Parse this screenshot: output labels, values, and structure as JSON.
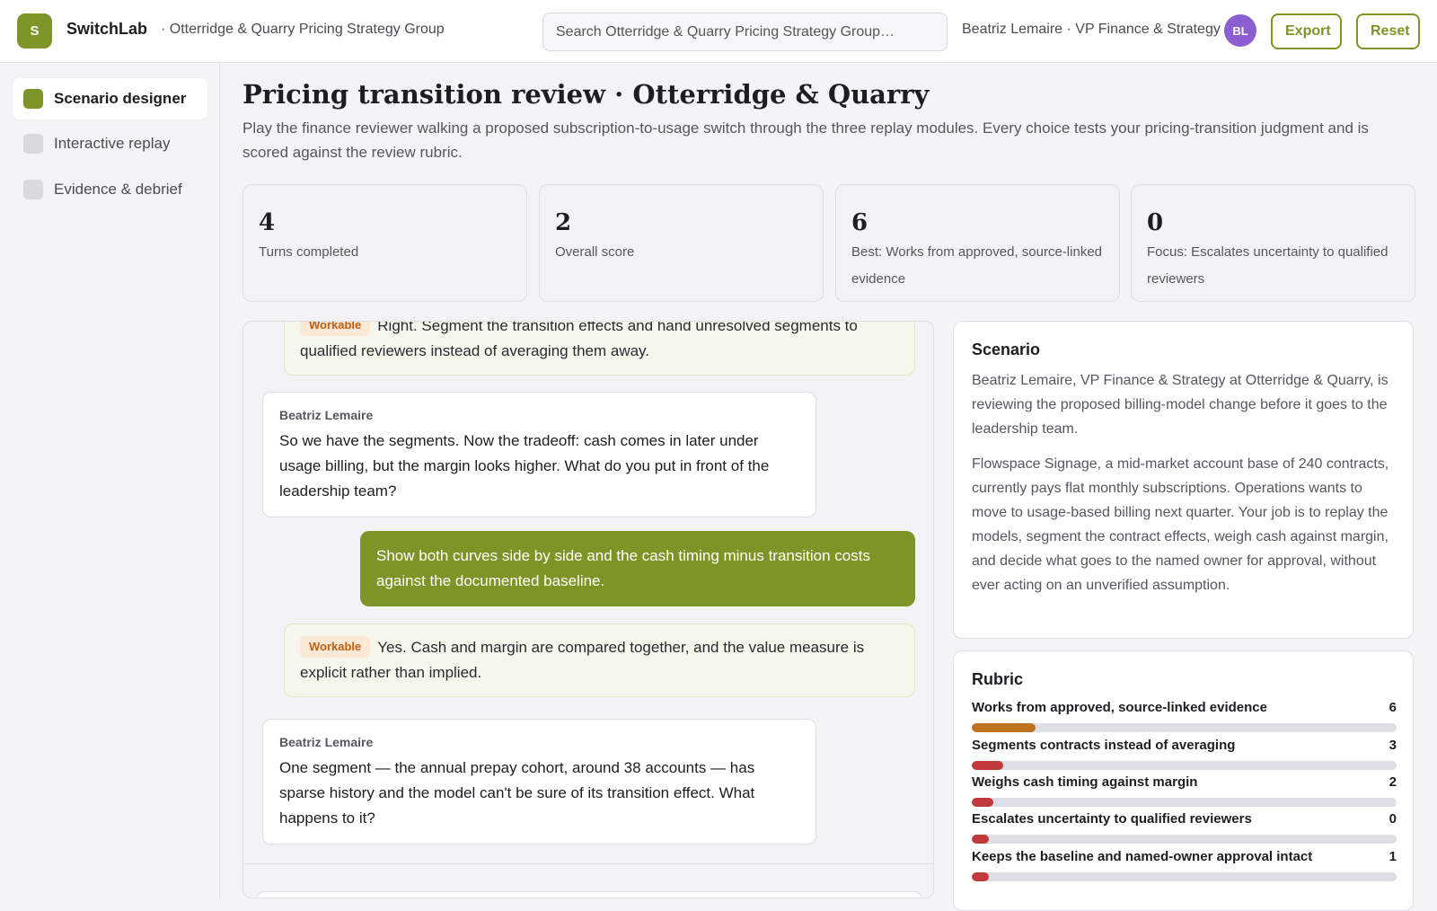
{
  "app": {
    "logo_letter": "S",
    "brand": "SwitchLab",
    "org": "· Otterridge & Quarry Pricing Strategy Group"
  },
  "search": {
    "value": "",
    "placeholder": "Search Otterridge & Quarry Pricing Strategy Group…"
  },
  "user": {
    "name": "Beatriz Lemaire · VP Finance & Strategy",
    "initials": "BL"
  },
  "toolbar": {
    "export_label": "Export",
    "reset_label": "Reset"
  },
  "sidebar": {
    "items": [
      {
        "label": "Scenario designer",
        "active": true
      },
      {
        "label": "Interactive replay",
        "active": false
      },
      {
        "label": "Evidence & debrief",
        "active": false
      }
    ]
  },
  "page": {
    "title": "Pricing transition review · Otterridge & Quarry",
    "description": "Play the finance reviewer walking a proposed subscription-to-usage switch through the three replay modules. Every choice tests your pricing-transition judgment and is scored against the review rubric."
  },
  "stats": [
    {
      "value": "4",
      "label": "Turns completed"
    },
    {
      "value": "2",
      "label": "Overall score"
    },
    {
      "value": "6",
      "label": "Best: Works from approved, source-linked evidence"
    },
    {
      "value": "0",
      "label": "Focus: Escalates uncertainty to qualified reviewers"
    }
  ],
  "chat": {
    "messages": [
      {
        "role": "evaluation",
        "tag": "Workable",
        "text": "Right. Segment the transition effects and hand unresolved segments to qualified reviewers instead of averaging them away."
      },
      {
        "role": "stakeholder",
        "speaker": "Beatriz Lemaire",
        "text": "So we have the segments. Now the tradeoff: cash comes in later under usage billing, but the margin looks higher. What do you put in front of the leadership team?"
      },
      {
        "role": "player",
        "text": "Show both curves side by side and the cash timing minus transition costs against the documented baseline."
      },
      {
        "role": "evaluation",
        "tag": "Workable",
        "text": "Yes. Cash and margin are compared together, and the value measure is explicit rather than implied."
      },
      {
        "role": "stakeholder",
        "speaker": "Beatriz Lemaire",
        "text": "One segment — the annual prepay cohort, around 38 accounts — has sparse history and the model can't be sure of its transition effect. What happens to it?"
      }
    ]
  },
  "scenario": {
    "heading": "Scenario",
    "paragraphs": [
      "Beatriz Lemaire, VP Finance & Strategy at Otterridge & Quarry, is reviewing the proposed billing-model change before it goes to the leadership team.",
      "Flowspace Signage, a mid-market account base of 240 contracts, currently pays flat monthly subscriptions. Operations wants to move to usage-based billing next quarter. Your job is to replay the models, segment the contract effects, weigh cash against margin, and decide what goes to the named owner for approval, without ever acting on an unverified assumption."
    ]
  },
  "rubric": {
    "heading": "Rubric",
    "max_score": 40,
    "items": [
      {
        "label": "Works from approved, source-linked evidence",
        "score": 6,
        "color": "#c0731f"
      },
      {
        "label": "Segments contracts instead of averaging",
        "score": 3,
        "color": "#c0393b"
      },
      {
        "label": "Weighs cash timing against margin",
        "score": 2,
        "color": "#c0393b"
      },
      {
        "label": "Escalates uncertainty to qualified reviewers",
        "score": 0,
        "color": "#c0393b"
      },
      {
        "label": "Keeps the baseline and named-owner approval intact",
        "score": 1,
        "color": "#c0393b"
      }
    ]
  }
}
